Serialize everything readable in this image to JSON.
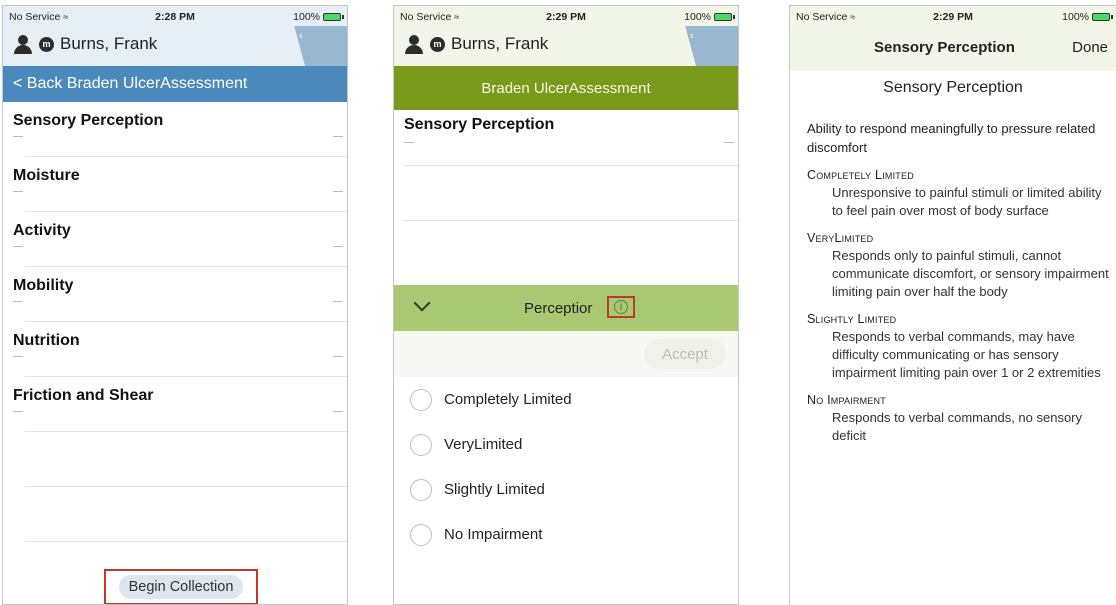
{
  "status_bars": [
    {
      "carrier": "No Service",
      "time": "2:28 PM",
      "battery": "100%"
    },
    {
      "carrier": "No Service",
      "time": "2:29 PM",
      "battery": "100%"
    },
    {
      "carrier": "No Service",
      "time": "2:29 PM",
      "battery": "100%"
    }
  ],
  "patient": {
    "name": "Burns, Frank",
    "badge": "m"
  },
  "screen1": {
    "nav_title": "< Back Braden UlcerAssessment",
    "items": [
      {
        "label": "Sensory Perception"
      },
      {
        "label": "Moisture"
      },
      {
        "label": "Activity"
      },
      {
        "label": "Mobility"
      },
      {
        "label": "Nutrition"
      },
      {
        "label": "Friction and Shear"
      }
    ],
    "begin_label": "Begin Collection"
  },
  "screen2": {
    "nav_title": "Braden UlcerAssessment",
    "section_title": "Sensory Perception",
    "perception_label": "Perceptior",
    "info_glyph": "i",
    "accept_label": "Accept",
    "options": [
      "Completely Limited",
      "VeryLimited",
      "Slightly Limited",
      "No Impairment"
    ]
  },
  "screen3": {
    "nav_title": "Sensory Perception",
    "done_label": "Done",
    "heading": "Sensory Perception",
    "description": "Ability to respond meaningfully to pressure related discomfort",
    "sections": [
      {
        "heading": "Completely Limited",
        "text": "Unresponsive to painful stimuli or limited ability to feel pain over most of body surface"
      },
      {
        "heading": "VeryLimited",
        "text": "Responds only to painful stimuli, cannot communicate discomfort, or sensory impairment limiting pain over half the body"
      },
      {
        "heading": "Slightly Limited",
        "text": "Responds to verbal commands, may have difficulty communicating or has sensory impairment limiting pain over 1 or 2 extremities"
      },
      {
        "heading": "No Impairment",
        "text": "Responds to verbal commands, no sensory deficit"
      }
    ]
  },
  "colors": {
    "blue_nav": "#4b89bd",
    "green_nav": "#7a9a1c",
    "perception_bar": "#a8c872",
    "highlight": "#c0392b"
  }
}
